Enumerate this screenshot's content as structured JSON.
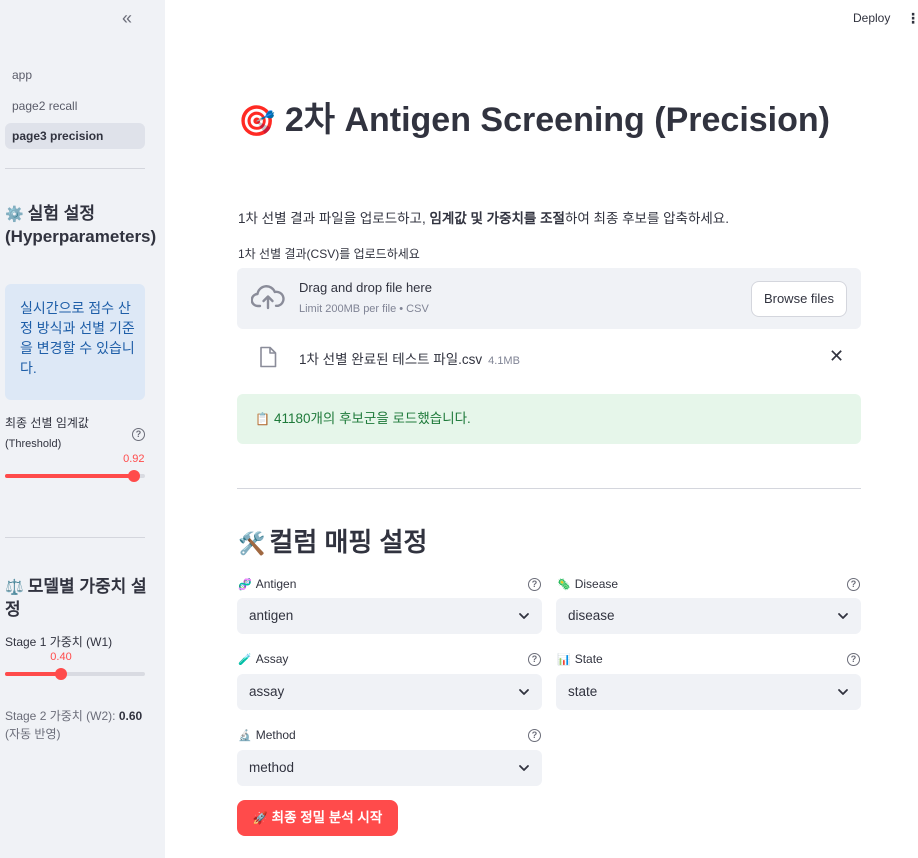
{
  "sidebar": {
    "collapse_glyph": "«",
    "nav": [
      {
        "label": "app"
      },
      {
        "label": "page2 recall"
      },
      {
        "label": "page3 precision"
      }
    ],
    "settings_heading_emoji": "⚙️",
    "settings_heading": "실험 설정 (Hyperparameters)",
    "info_text": "실시간으로 점수 산정 방식과 선별 기준을 변경할 수 있습니다.",
    "threshold": {
      "label_line1": "최종 선별 임계값",
      "label_line2": "(Threshold)",
      "value_text": "0.92",
      "value": 0.92,
      "min": 0.0,
      "max": 1.0
    },
    "weights_heading_emoji": "⚖️",
    "weights_heading": "모델별 가중치 설정",
    "w1": {
      "label": "Stage 1 가중치 (W1)",
      "value_text": "0.40",
      "value": 0.4,
      "min": 0.0,
      "max": 1.0
    },
    "w2": {
      "label_prefix": "Stage 2 가중치 (W2): ",
      "value_text": "0.60",
      "label_suffix": "(자동 반영)"
    }
  },
  "header": {
    "deploy_label": "Deploy",
    "menu_glyph": "⋮"
  },
  "main": {
    "title_emoji": "🎯",
    "title": "2차 Antigen Screening (Precision)",
    "desc_part1": "1차 선별 결과 파일을 업로드하고, ",
    "desc_bold": "임계값 및 가중치를 조절",
    "desc_part2": "하여 최종 후보를 압축하세요.",
    "uploader": {
      "label": "1차 선별 결과(CSV)를 업로드하세요",
      "drag_text": "Drag and drop file here",
      "limit_text": "Limit 200MB per file • CSV",
      "browse_label": "Browse files"
    },
    "file": {
      "name": "1차 선별 완료된 테스트 파일.csv",
      "size": "4.1MB",
      "close_glyph": "✕"
    },
    "success": {
      "emoji": "📋",
      "text": "41180개의 후보군을 로드했습니다."
    },
    "mapping": {
      "heading_emoji": "🛠️",
      "heading": "컬럼 매핑 설정",
      "fields": [
        {
          "emoji": "🧬",
          "label": "Antigen",
          "value": "antigen"
        },
        {
          "emoji": "🦠",
          "label": "Disease",
          "value": "disease"
        },
        {
          "emoji": "🧪",
          "label": "Assay",
          "value": "assay"
        },
        {
          "emoji": "📊",
          "label": "State",
          "value": "state"
        },
        {
          "emoji": "🔬",
          "label": "Method",
          "value": "method"
        }
      ]
    },
    "run_button": {
      "emoji": "🚀",
      "label": "최종 정밀 분석 시작"
    }
  },
  "colors": {
    "accent": "#ff4b4b",
    "sidebar_bg": "#f0f2f6",
    "info_bg": "#dde8f6",
    "success_bg": "#e6f6ea"
  }
}
